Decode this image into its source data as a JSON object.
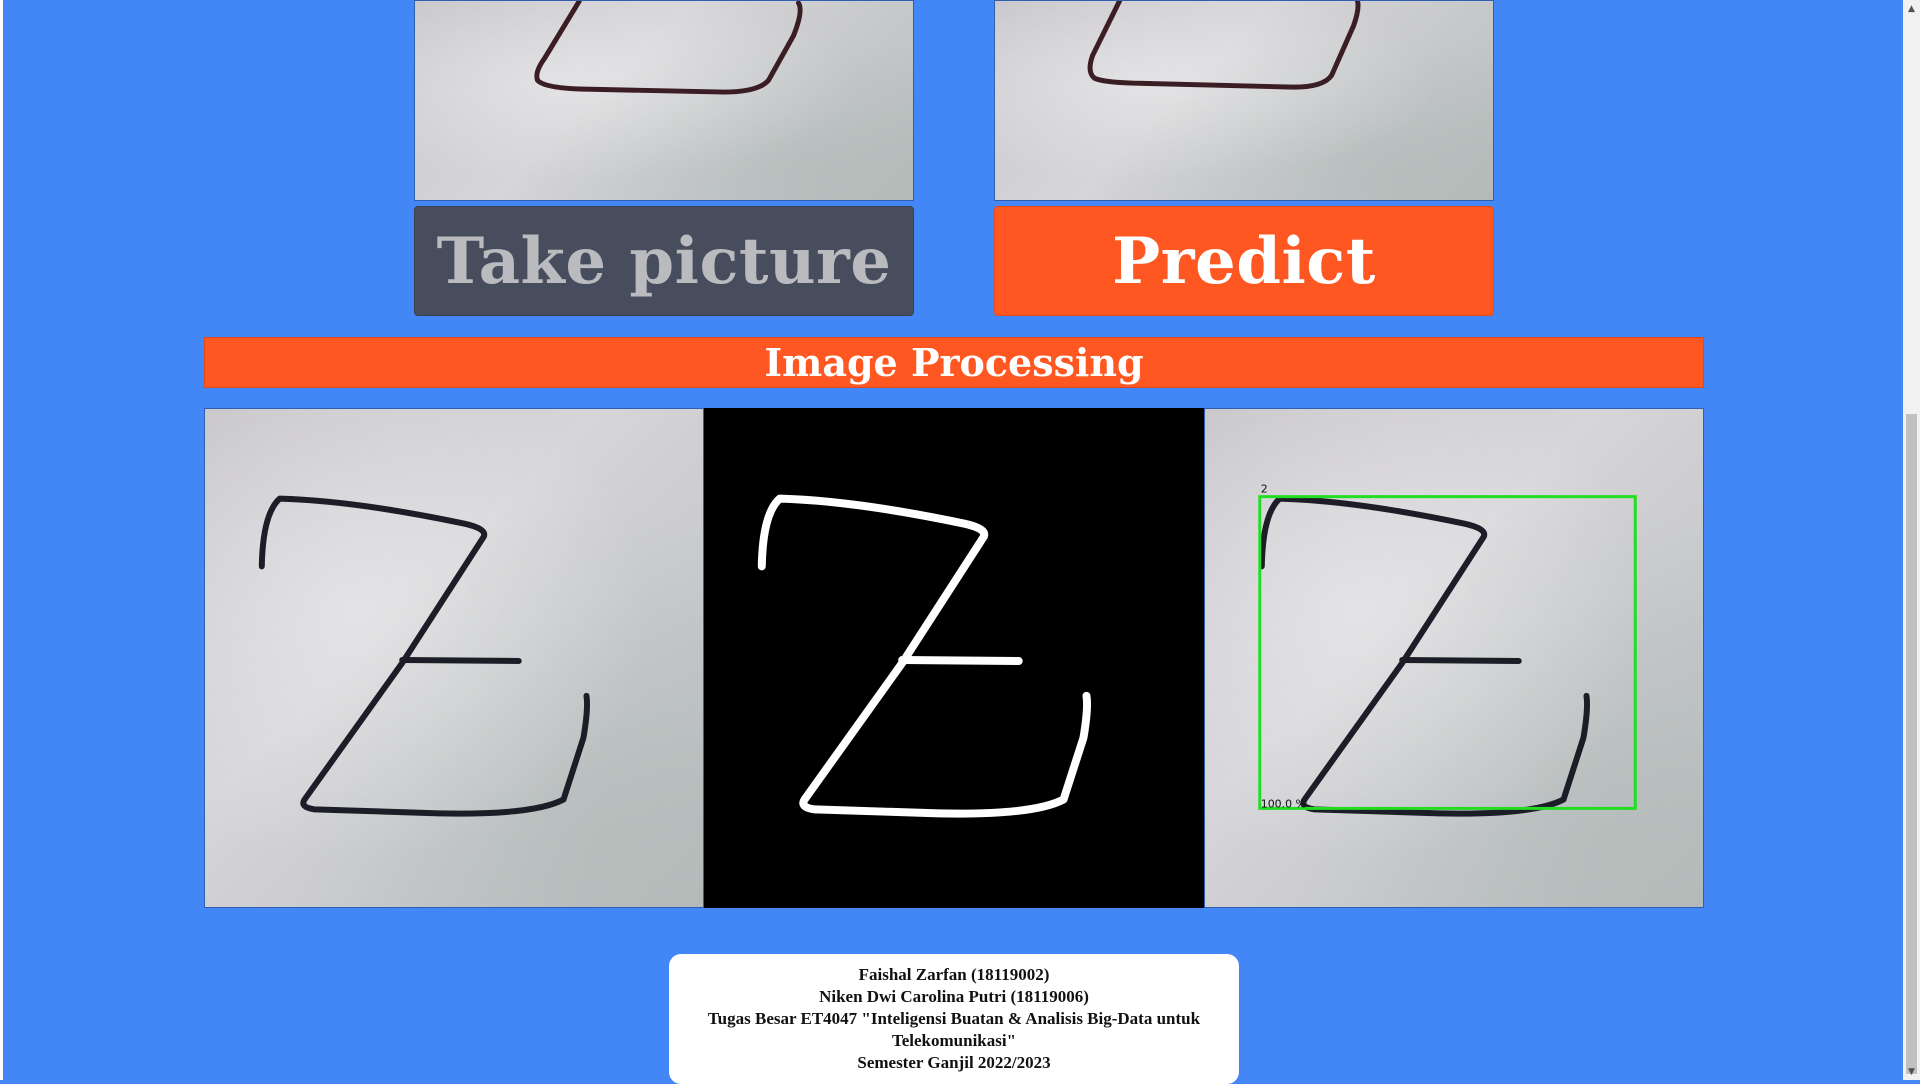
{
  "buttons": {
    "take_picture": "Take picture",
    "predict": "Predict"
  },
  "section": {
    "title": "Image Processing"
  },
  "processing": {
    "result_label": "2",
    "confidence": "100.0 %"
  },
  "footer": {
    "line1": "Faishal Zarfan (18119002)",
    "line2": "Niken Dwi Carolina Putri (18119006)",
    "line3": "Tugas Besar ET4047 \"Inteligensi Buatan & Analisis Big-Data untuk Telekomunikasi\"",
    "line4": "Semester Ganjil 2022/2023"
  },
  "colors": {
    "background": "#4287f5",
    "accent": "#ff5722",
    "button_dark": "#474d5d",
    "bbox": "#22dd22"
  },
  "icons": {
    "scroll_up": "chevron-up-icon",
    "scroll_down": "chevron-down-icon"
  }
}
